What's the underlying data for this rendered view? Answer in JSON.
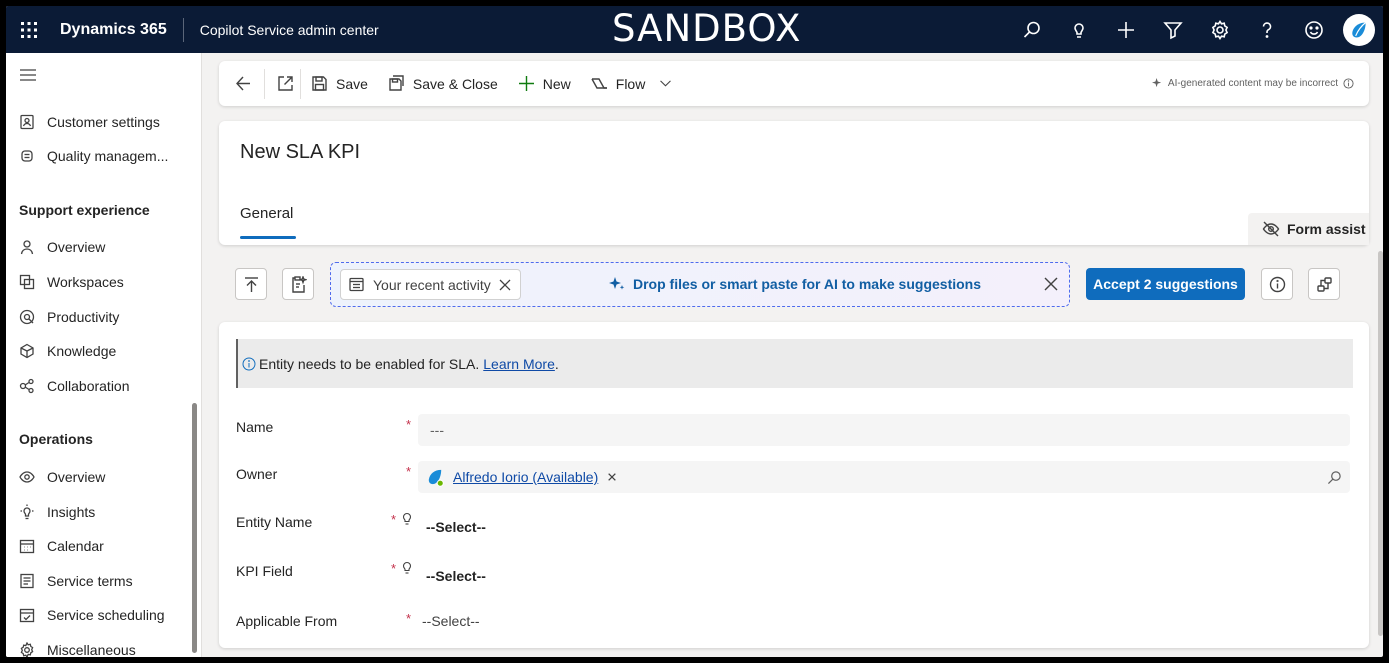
{
  "topbar": {
    "brand": "Dynamics 365",
    "app_name": "Copilot Service admin center",
    "environment_banner": "SANDBOX",
    "icons": [
      "search-icon",
      "lightbulb-icon",
      "plus-icon",
      "filter-icon",
      "settings-icon",
      "help-icon",
      "feedback-icon",
      "avatar-icon"
    ]
  },
  "sidebar": {
    "top_items": [
      {
        "label": "Customer settings",
        "icon": "contact-card-icon"
      },
      {
        "label": "Quality managem...",
        "icon": "quality-icon"
      }
    ],
    "support_experience": {
      "heading": "Support experience",
      "items": [
        {
          "label": "Overview",
          "icon": "person-icon"
        },
        {
          "label": "Workspaces",
          "icon": "workspaces-icon"
        },
        {
          "label": "Productivity",
          "icon": "productivity-icon"
        },
        {
          "label": "Knowledge",
          "icon": "knowledge-icon"
        },
        {
          "label": "Collaboration",
          "icon": "collaboration-icon"
        }
      ]
    },
    "operations": {
      "heading": "Operations",
      "items": [
        {
          "label": "Overview",
          "icon": "eye-icon"
        },
        {
          "label": "Insights",
          "icon": "insights-icon"
        },
        {
          "label": "Calendar",
          "icon": "calendar-icon"
        },
        {
          "label": "Service terms",
          "icon": "service-terms-icon"
        },
        {
          "label": "Service scheduling",
          "icon": "scheduling-icon"
        },
        {
          "label": "Miscellaneous",
          "icon": "gear-icon"
        }
      ]
    }
  },
  "commandbar": {
    "save": "Save",
    "save_close": "Save & Close",
    "new": "New",
    "flow": "Flow",
    "ai_note": "AI-generated content may be incorrect"
  },
  "header": {
    "title": "New SLA KPI",
    "tab_general": "General",
    "form_assist": "Form assist"
  },
  "assist": {
    "chip_label": "Your recent activity",
    "drop_text": "Drop files or smart paste for AI to make suggestions",
    "accept_button": "Accept 2 suggestions"
  },
  "form": {
    "notice_text": "Entity needs to be enabled for SLA.",
    "notice_link": "Learn More",
    "notice_period": ".",
    "fields": {
      "name_label": "Name",
      "name_value": "---",
      "owner_label": "Owner",
      "owner_value": "Alfredo Iorio (Available)",
      "entity_label": "Entity Name",
      "entity_value": "--Select--",
      "kpi_label": "KPI Field",
      "kpi_value": "--Select--",
      "applicable_label": "Applicable From",
      "applicable_value": "--Select--"
    },
    "required_mark": "*"
  },
  "colors": {
    "topbar_bg": "#0b1b36",
    "accent": "#0f6cbd",
    "required": "#c4314b",
    "link": "#0f4aa6"
  }
}
